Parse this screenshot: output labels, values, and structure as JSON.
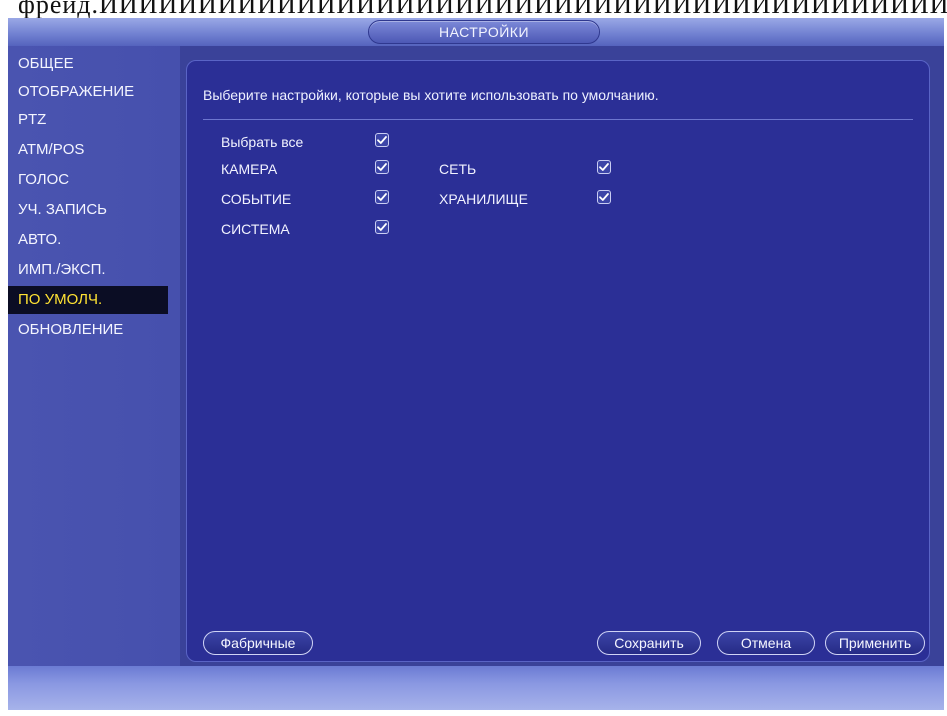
{
  "caption": "фрейд.ИИИИИИИИИИИИИИИИИИИИИИИИИИИИИИИИИИИИИИИИИИИИИИИИИИИИИИИИИИИИИИ",
  "window": {
    "title": "НАСТРОЙКИ"
  },
  "sidebar": {
    "items": [
      {
        "label": "ОБЩЕЕ"
      },
      {
        "label": "ОТОБРАЖЕНИЕ"
      },
      {
        "label": "PTZ"
      },
      {
        "label": "ATM/POS"
      },
      {
        "label": "ГОЛОС"
      },
      {
        "label": "УЧ. ЗАПИСЬ"
      },
      {
        "label": "АВТО."
      },
      {
        "label": "ИМП./ЭКСП."
      },
      {
        "label": "ПО УМОЛЧ."
      },
      {
        "label": "ОБНОВЛЕНИЕ"
      }
    ],
    "active_item": "ПО УМОЛЧ."
  },
  "main": {
    "hint": "Выберите настройки, которые вы хотите использовать по умолчанию.",
    "select_all": {
      "label": "Выбрать все",
      "checked": true
    },
    "options": {
      "camera": {
        "label": "КАМЕРА",
        "checked": true
      },
      "network": {
        "label": "СЕТЬ",
        "checked": true
      },
      "event": {
        "label": "СОБЫТИЕ",
        "checked": true
      },
      "storage": {
        "label": "ХРАНИЛИЩЕ",
        "checked": true
      },
      "system": {
        "label": "СИСТЕМА",
        "checked": true
      }
    }
  },
  "buttons": {
    "factory": "Фабричные",
    "save": "Сохранить",
    "cancel": "Отмена",
    "apply": "Применить"
  },
  "colors": {
    "panel_bg": "#2b2f96",
    "active_nav_text": "#ffe233",
    "active_nav_bg": "#0b0d24"
  },
  "icons": {
    "checkbox": "checkmark-icon"
  }
}
